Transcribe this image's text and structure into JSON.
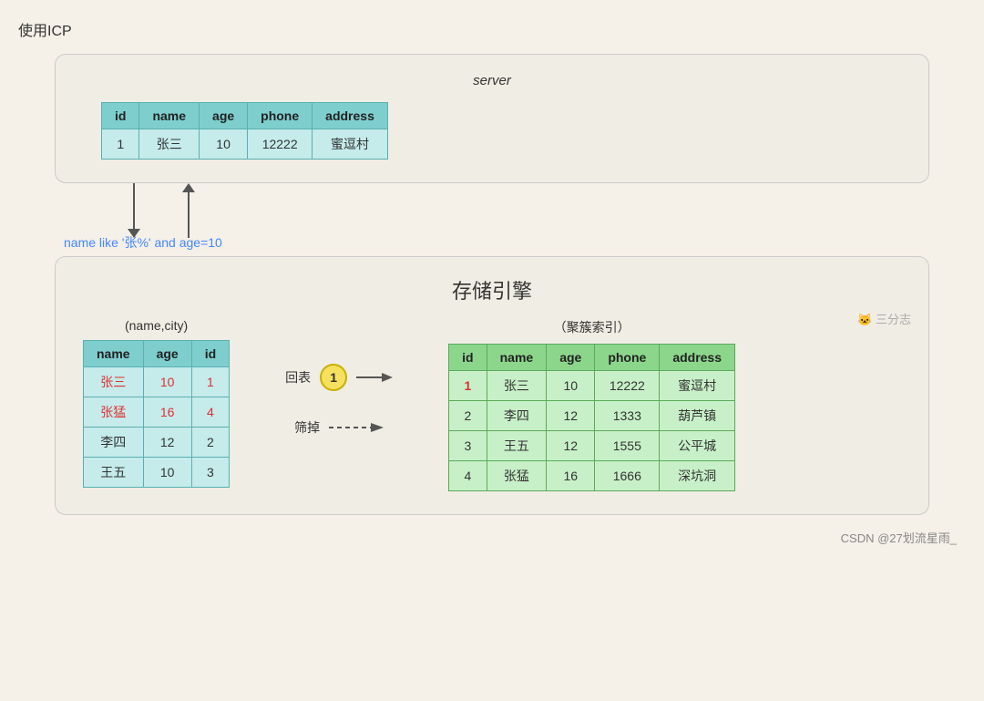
{
  "title": "使用ICP",
  "server": {
    "label": "server",
    "table": {
      "headers": [
        "id",
        "name",
        "age",
        "phone",
        "address"
      ],
      "rows": [
        [
          "1",
          "张三",
          "10",
          "12222",
          "蜜逗村"
        ]
      ]
    }
  },
  "query": {
    "label": "name like '张%' and age=10"
  },
  "engine": {
    "label": "存储引擎",
    "left_label": "(name,city)",
    "left_table": {
      "headers": [
        "name",
        "age",
        "id"
      ],
      "rows": [
        {
          "cells": [
            "张三",
            "10",
            "1"
          ],
          "red": [
            true,
            true,
            true
          ]
        },
        {
          "cells": [
            "张猛",
            "16",
            "4"
          ],
          "red": [
            true,
            true,
            true
          ]
        },
        {
          "cells": [
            "李四",
            "12",
            "2"
          ],
          "red": [
            false,
            false,
            false
          ]
        },
        {
          "cells": [
            "王五",
            "10",
            "3"
          ],
          "red": [
            false,
            false,
            false
          ]
        }
      ]
    },
    "arrow_label": "回表",
    "badge": "1",
    "shai_label": "筛掉",
    "right_label": "（聚簇索引）",
    "right_table": {
      "headers": [
        "id",
        "name",
        "age",
        "phone",
        "address"
      ],
      "rows": [
        {
          "cells": [
            "1",
            "张三",
            "10",
            "12222",
            "蜜逗村"
          ],
          "red_first": true
        },
        {
          "cells": [
            "2",
            "李四",
            "12",
            "1333",
            "葫芦镇"
          ],
          "red_first": false
        },
        {
          "cells": [
            "3",
            "王五",
            "12",
            "1555",
            "公平城"
          ],
          "red_first": false
        },
        {
          "cells": [
            "4",
            "张猛",
            "16",
            "1666",
            "深坑洞"
          ],
          "red_first": false
        }
      ]
    }
  },
  "watermark": "三分志",
  "footer": "CSDN @27划流星雨_"
}
